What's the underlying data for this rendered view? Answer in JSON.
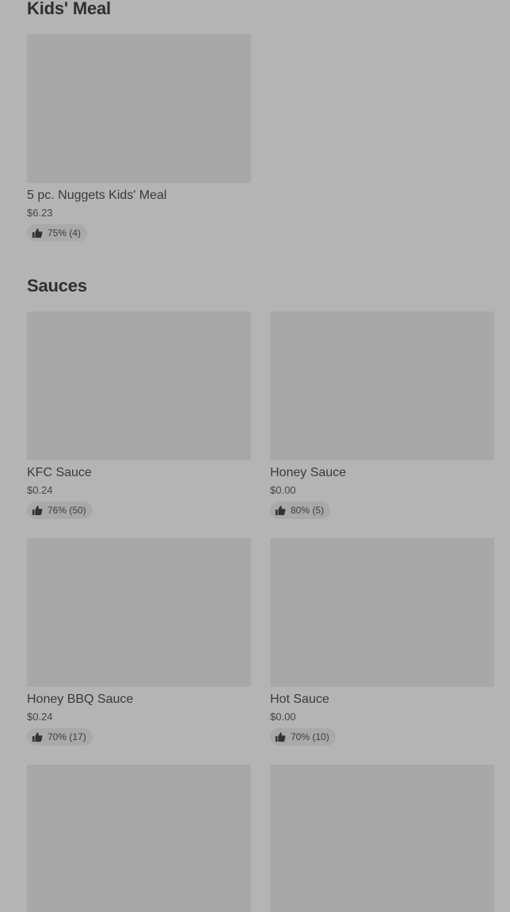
{
  "sections": [
    {
      "title": "Kids' Meal",
      "items": [
        {
          "name": "5 pc. Nuggets Kids' Meal",
          "price": "$6.23",
          "rating": "75% (4)"
        }
      ]
    },
    {
      "title": "Sauces",
      "items": [
        {
          "name": "KFC Sauce",
          "price": "$0.24",
          "rating": "76% (50)"
        },
        {
          "name": "Honey Sauce",
          "price": "$0.00",
          "rating": "80% (5)"
        },
        {
          "name": "Honey BBQ Sauce",
          "price": "$0.24",
          "rating": "70% (17)"
        },
        {
          "name": "Hot Sauce",
          "price": "$0.00",
          "rating": "70% (10)"
        }
      ]
    }
  ],
  "icons": {
    "rating": "thumbs-up-icon"
  },
  "colors": {
    "background": "#b4b4b4",
    "image_placeholder": "#a8a8a8",
    "rating_pill": "#a9a9a9"
  }
}
